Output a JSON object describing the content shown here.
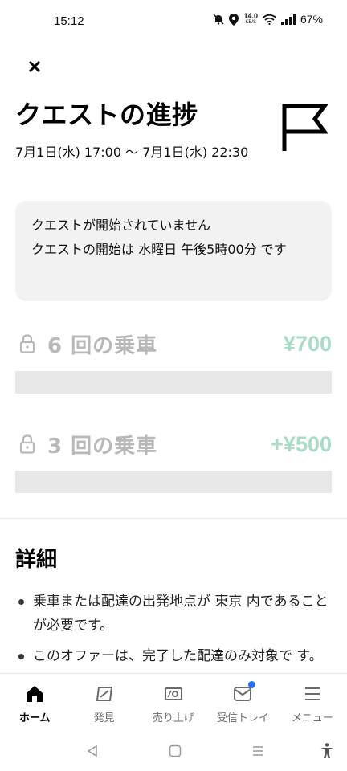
{
  "status_bar": {
    "time": "15:12",
    "net_speed_value": "14.0",
    "net_speed_unit": "KB/S",
    "battery": "67%"
  },
  "header": {
    "title": "クエストの進捗",
    "date_range": "7月1日(水) 17:00 〜 7月1日(水) 22:30"
  },
  "notice": {
    "line1": "クエストが開始されていません",
    "line2": "クエストの開始は 水曜日 午後5時00分 です"
  },
  "quests": [
    {
      "label": "6 回の乗車",
      "reward": "¥700",
      "progress": 0
    },
    {
      "label": "3 回の乗車",
      "reward": "+¥500",
      "progress": 0
    }
  ],
  "details": {
    "title": "詳細",
    "items": [
      "乗車または配達の出発地点が 東京 内であることが必要です。",
      "このオファーは、完了した配達のみ対象で す。"
    ]
  },
  "nav": {
    "home": "ホーム",
    "discover": "発見",
    "earnings": "売り上げ",
    "inbox": "受信トレイ",
    "menu": "メニュー"
  },
  "colors": {
    "reward_green": "#a8dcc4",
    "locked_gray": "#b8b8b8",
    "badge_blue": "#276ef1"
  },
  "icons": [
    "close-icon",
    "flag-icon",
    "lock-icon",
    "home-icon",
    "discover-icon",
    "earnings-icon",
    "inbox-icon",
    "menu-icon"
  ]
}
